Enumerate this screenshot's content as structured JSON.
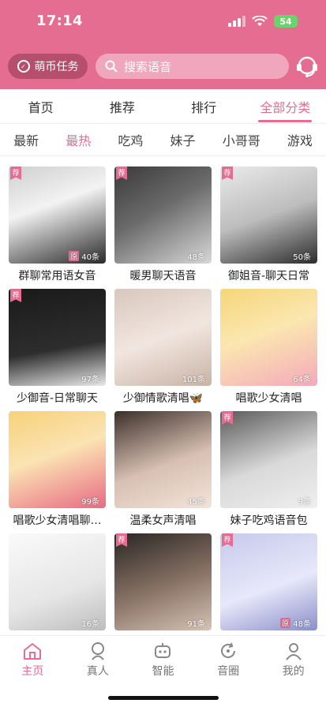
{
  "status": {
    "time": "17:14",
    "battery": "54"
  },
  "header": {
    "task_label": "萌币任务",
    "search_placeholder": "搜索语音"
  },
  "tabs": [
    {
      "label": "首页"
    },
    {
      "label": "推荐"
    },
    {
      "label": "排行"
    },
    {
      "label": "全部分类"
    }
  ],
  "active_tab": "全部分类",
  "subtabs": [
    {
      "label": "最新"
    },
    {
      "label": "最热"
    },
    {
      "label": "吃鸡"
    },
    {
      "label": "妹子"
    },
    {
      "label": "小哥哥"
    },
    {
      "label": "游戏"
    }
  ],
  "active_subtab": "最热",
  "cards": [
    {
      "title": "群聊常用语女音",
      "count": "40条",
      "rec": "荐",
      "orig": "原"
    },
    {
      "title": "暖男聊天语音",
      "count": "48条",
      "rec": "荐"
    },
    {
      "title": "御姐音-聊天日常",
      "count": "50条",
      "rec": "荐"
    },
    {
      "title": "少御音-日常聊天",
      "count": "97条",
      "rec": "荐"
    },
    {
      "title": "少御情歌清唱🦋",
      "count": "101条"
    },
    {
      "title": "唱歌少女清唱",
      "count": "64条"
    },
    {
      "title": "唱歌少女清唱聊…",
      "count": "99条"
    },
    {
      "title": "温柔女声清唱",
      "count": "45条"
    },
    {
      "title": "妹子吃鸡语音包",
      "count": "9条",
      "rec": "荐"
    },
    {
      "title": "",
      "count": "16条"
    },
    {
      "title": "",
      "count": "91条",
      "rec": "荐"
    },
    {
      "title": "",
      "count": "48条",
      "rec": "荐",
      "orig": "原"
    }
  ],
  "bottom_nav": [
    {
      "label": "主页"
    },
    {
      "label": "真人"
    },
    {
      "label": "智能"
    },
    {
      "label": "音圈"
    },
    {
      "label": "我的"
    }
  ],
  "active_nav": "主页",
  "colors": {
    "accent": "#e46d91",
    "header": "#e46d91"
  }
}
